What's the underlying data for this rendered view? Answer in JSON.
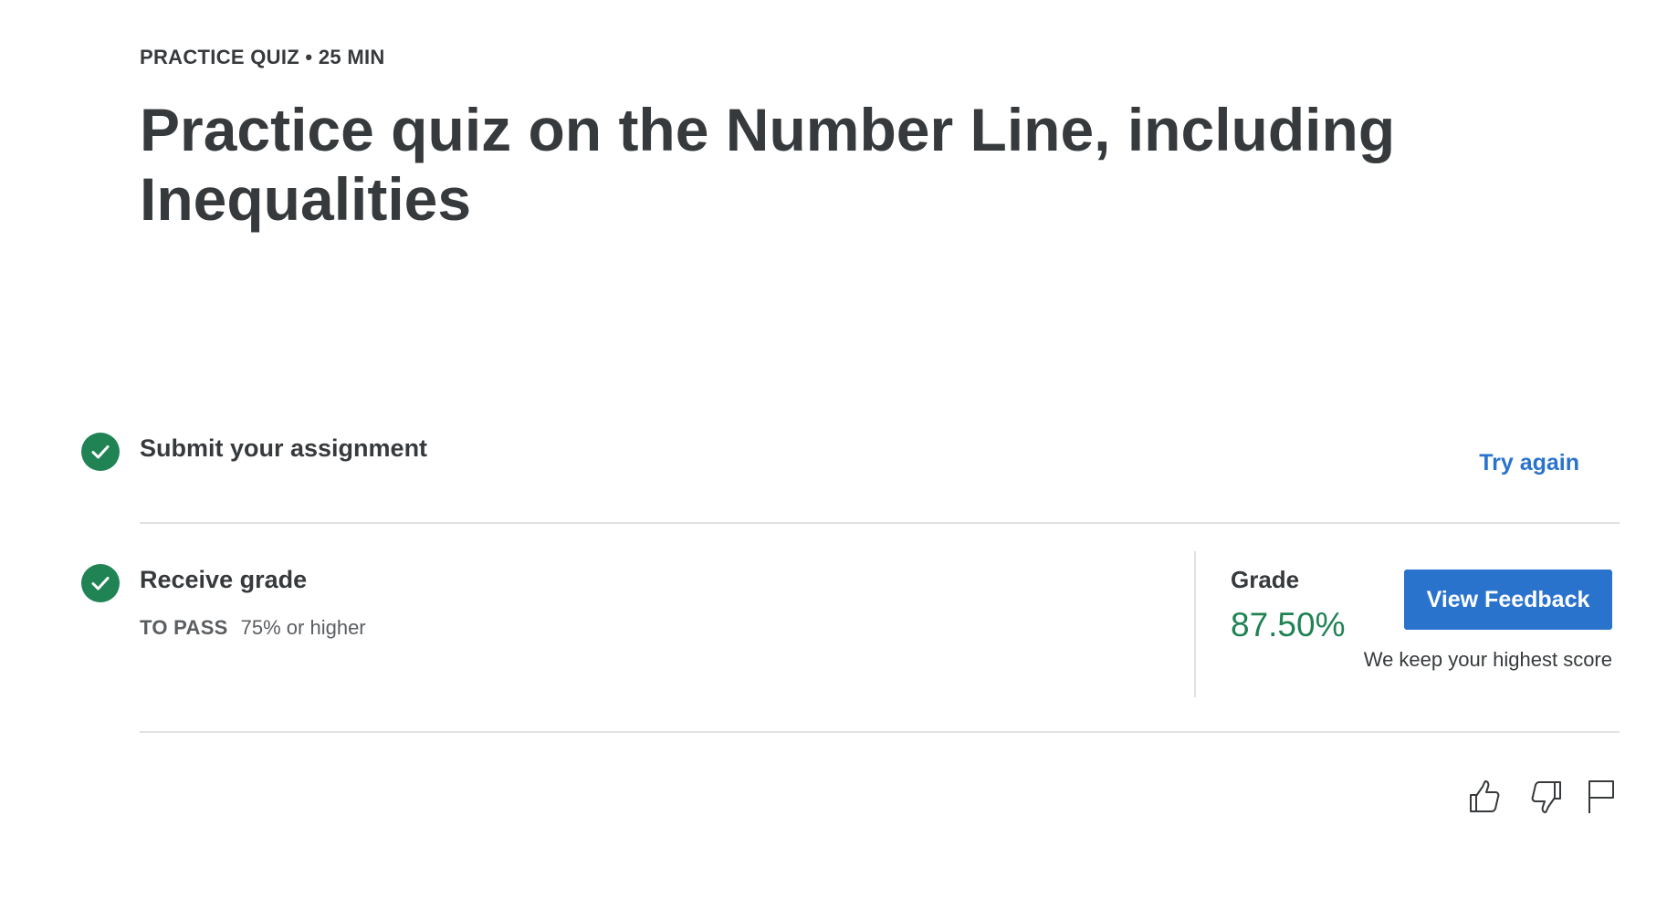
{
  "header": {
    "eyebrow": "PRACTICE QUIZ • 25 MIN",
    "title": "Practice quiz on the Number Line, including Inequalities"
  },
  "steps": {
    "submit": {
      "title": "Submit your assignment",
      "action_label": "Try again",
      "status_icon": "check-circle-icon"
    },
    "receive": {
      "title": "Receive grade",
      "status_icon": "check-circle-icon",
      "pass_label": "TO PASS",
      "pass_requirement": "75% or higher"
    }
  },
  "grade": {
    "label": "Grade",
    "value": "87.50%",
    "button_label": "View Feedback",
    "note": "We keep your highest score"
  },
  "footer_actions": {
    "like": "thumbs-up-icon",
    "dislike": "thumbs-down-icon",
    "report": "flag-icon"
  },
  "colors": {
    "accent": "#2a73cc",
    "success": "#1f8354",
    "text": "#373a3c",
    "divider": "#e1e1e1"
  }
}
